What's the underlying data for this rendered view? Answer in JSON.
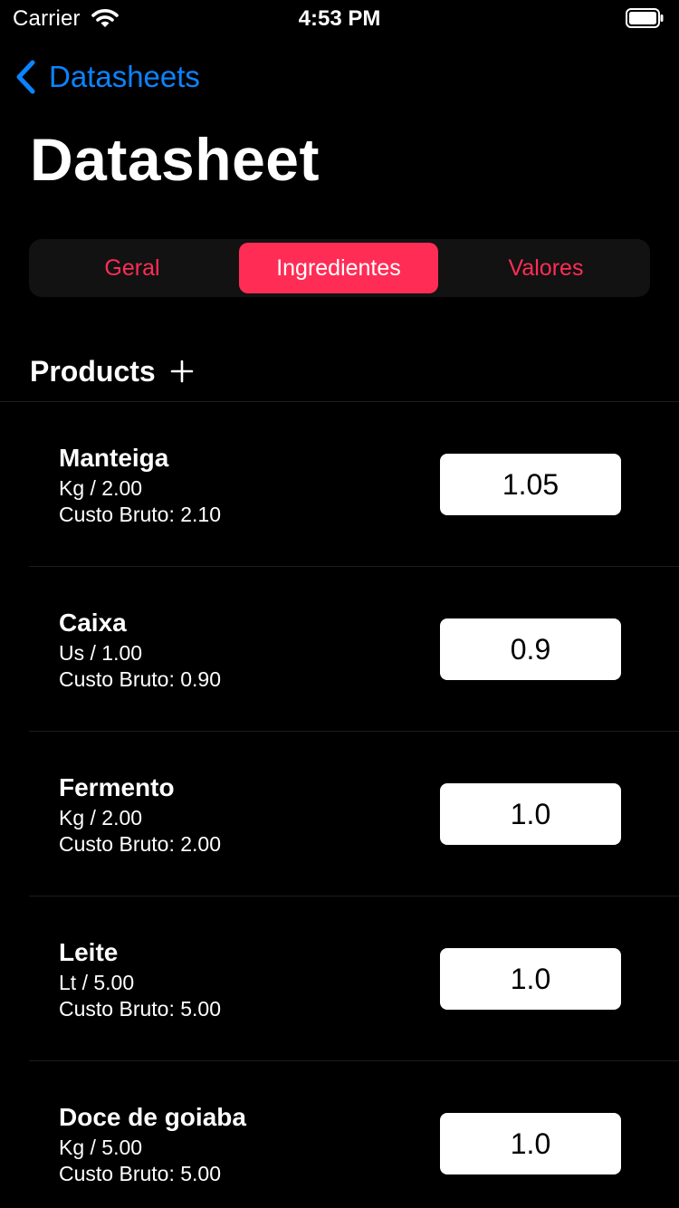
{
  "status_bar": {
    "carrier": "Carrier",
    "time": "4:53 PM"
  },
  "nav": {
    "back_label": "Datasheets",
    "accent_color": "#0a84ff"
  },
  "page": {
    "title": "Datasheet"
  },
  "segments": {
    "items": [
      {
        "label": "Geral",
        "active": false
      },
      {
        "label": "Ingredientes",
        "active": true
      },
      {
        "label": "Valores",
        "active": false
      }
    ],
    "accent_color": "#ff2d55"
  },
  "section": {
    "title": "Products",
    "add_icon": "plus-icon"
  },
  "products": [
    {
      "name": "Manteiga",
      "unit": "Kg / 2.00",
      "cost": "Custo Bruto: 2.10",
      "value": "1.05"
    },
    {
      "name": "Caixa",
      "unit": "Us / 1.00",
      "cost": "Custo Bruto: 0.90",
      "value": "0.9"
    },
    {
      "name": "Fermento",
      "unit": "Kg / 2.00",
      "cost": "Custo Bruto: 2.00",
      "value": "1.0"
    },
    {
      "name": "Leite",
      "unit": "Lt / 5.00",
      "cost": "Custo Bruto: 5.00",
      "value": "1.0"
    },
    {
      "name": "Doce de goiaba",
      "unit": "Kg / 5.00",
      "cost": "Custo Bruto: 5.00",
      "value": "1.0"
    }
  ]
}
